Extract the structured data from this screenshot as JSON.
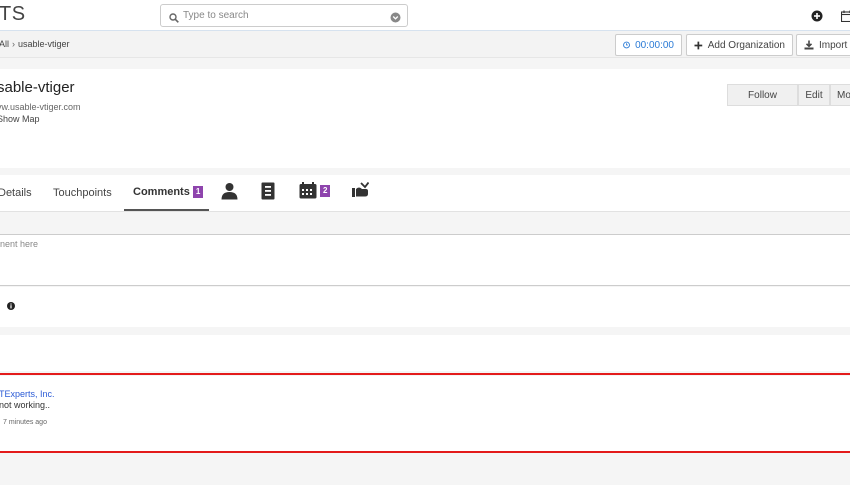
{
  "app": {
    "title": "TS"
  },
  "search": {
    "placeholder": "Type to search"
  },
  "breadcrumb": {
    "parent": "All",
    "current": "usable-vtiger"
  },
  "actions": {
    "timer": "00:00:00",
    "add_organization": "Add Organization",
    "import": "Import"
  },
  "record": {
    "name": "sable-vtiger",
    "website": "vw.usable-vtiger.com",
    "show_map": "Show Map"
  },
  "record_actions": {
    "follow": "Follow",
    "edit": "Edit",
    "more": "Mo"
  },
  "tabs": {
    "details": "Details",
    "touchpoints": "Touchpoints",
    "comments": "Comments",
    "comments_count": "1",
    "activities_count": "2"
  },
  "composer": {
    "placeholder": "nent here"
  },
  "comments": [
    {
      "author": "TExperts, Inc.",
      "text": "not working..",
      "time": "7 minutes ago"
    }
  ],
  "colors": {
    "accent": "#8e44ad",
    "link": "#2b5bd6",
    "highlight": "#e31b1b",
    "timer": "#2b7bd6"
  }
}
